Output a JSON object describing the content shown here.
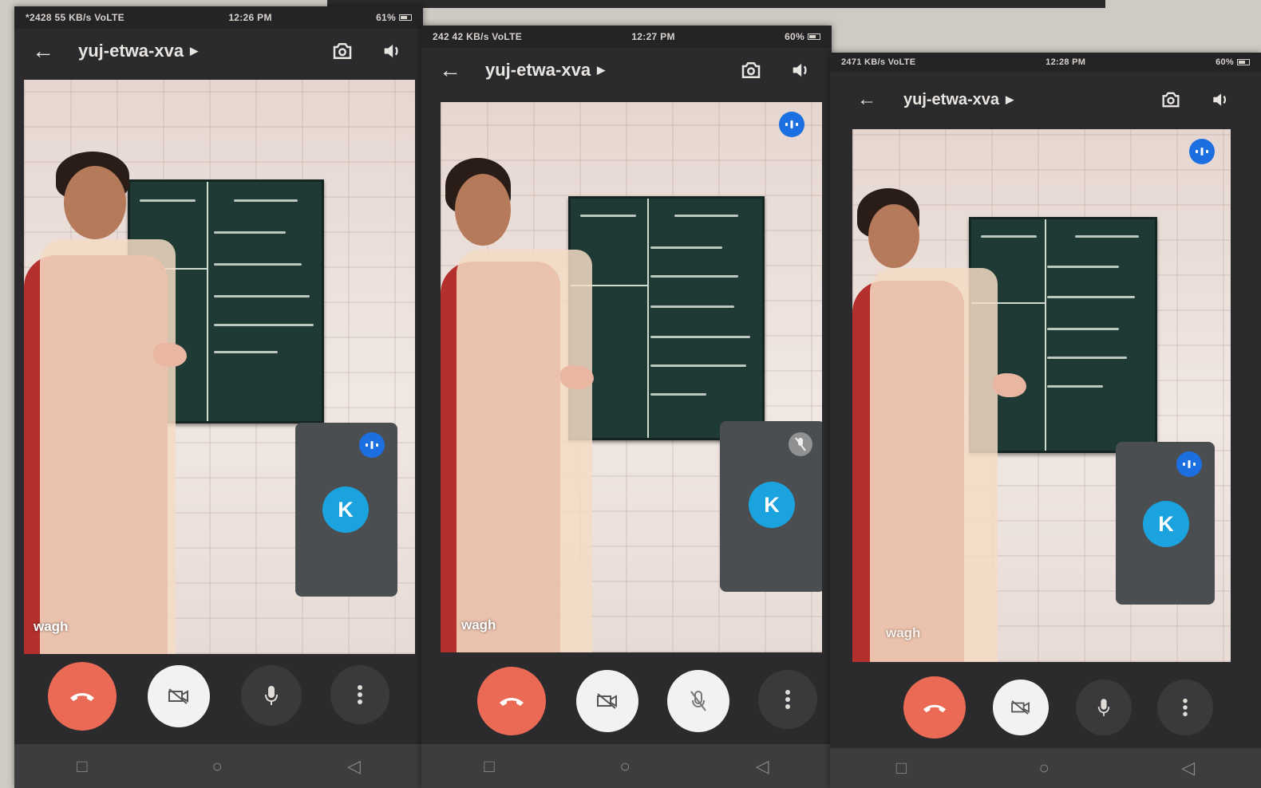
{
  "phones": [
    {
      "status": {
        "network": "*2428 55 KB/s VoLTE",
        "time": "12:26 PM",
        "battery": "61%"
      },
      "meeting_code": "yuj-etwa-xva",
      "caption_name": "wagh",
      "self_avatar_initial": "K",
      "self_muted": false
    },
    {
      "status": {
        "network": "242 42 KB/s VoLTE",
        "time": "12:27 PM",
        "battery": "60%"
      },
      "meeting_code": "yuj-etwa-xva",
      "caption_name": "wagh",
      "self_avatar_initial": "K",
      "self_muted": true
    },
    {
      "status": {
        "network": "2471 KB/s VoLTE",
        "time": "12:28 PM",
        "battery": "60%"
      },
      "meeting_code": "yuj-etwa-xva",
      "caption_name": "wagh",
      "self_avatar_initial": "K",
      "self_muted": false
    }
  ],
  "icons": {
    "back": "back-arrow-icon",
    "switch_camera": "switch-camera-icon",
    "speaker": "speaker-icon",
    "active_speaker": "audio-level-icon",
    "end_call": "phone-hangup-icon",
    "camera_off": "video-off-icon",
    "mic": "microphone-icon",
    "mic_off": "microphone-off-icon",
    "more": "more-vert-icon"
  },
  "colors": {
    "end_call": "#ea6a55",
    "avatar": "#1aa3df",
    "speaker_badge": "#1b6fe0",
    "phone_bg": "#2b2a2c"
  }
}
